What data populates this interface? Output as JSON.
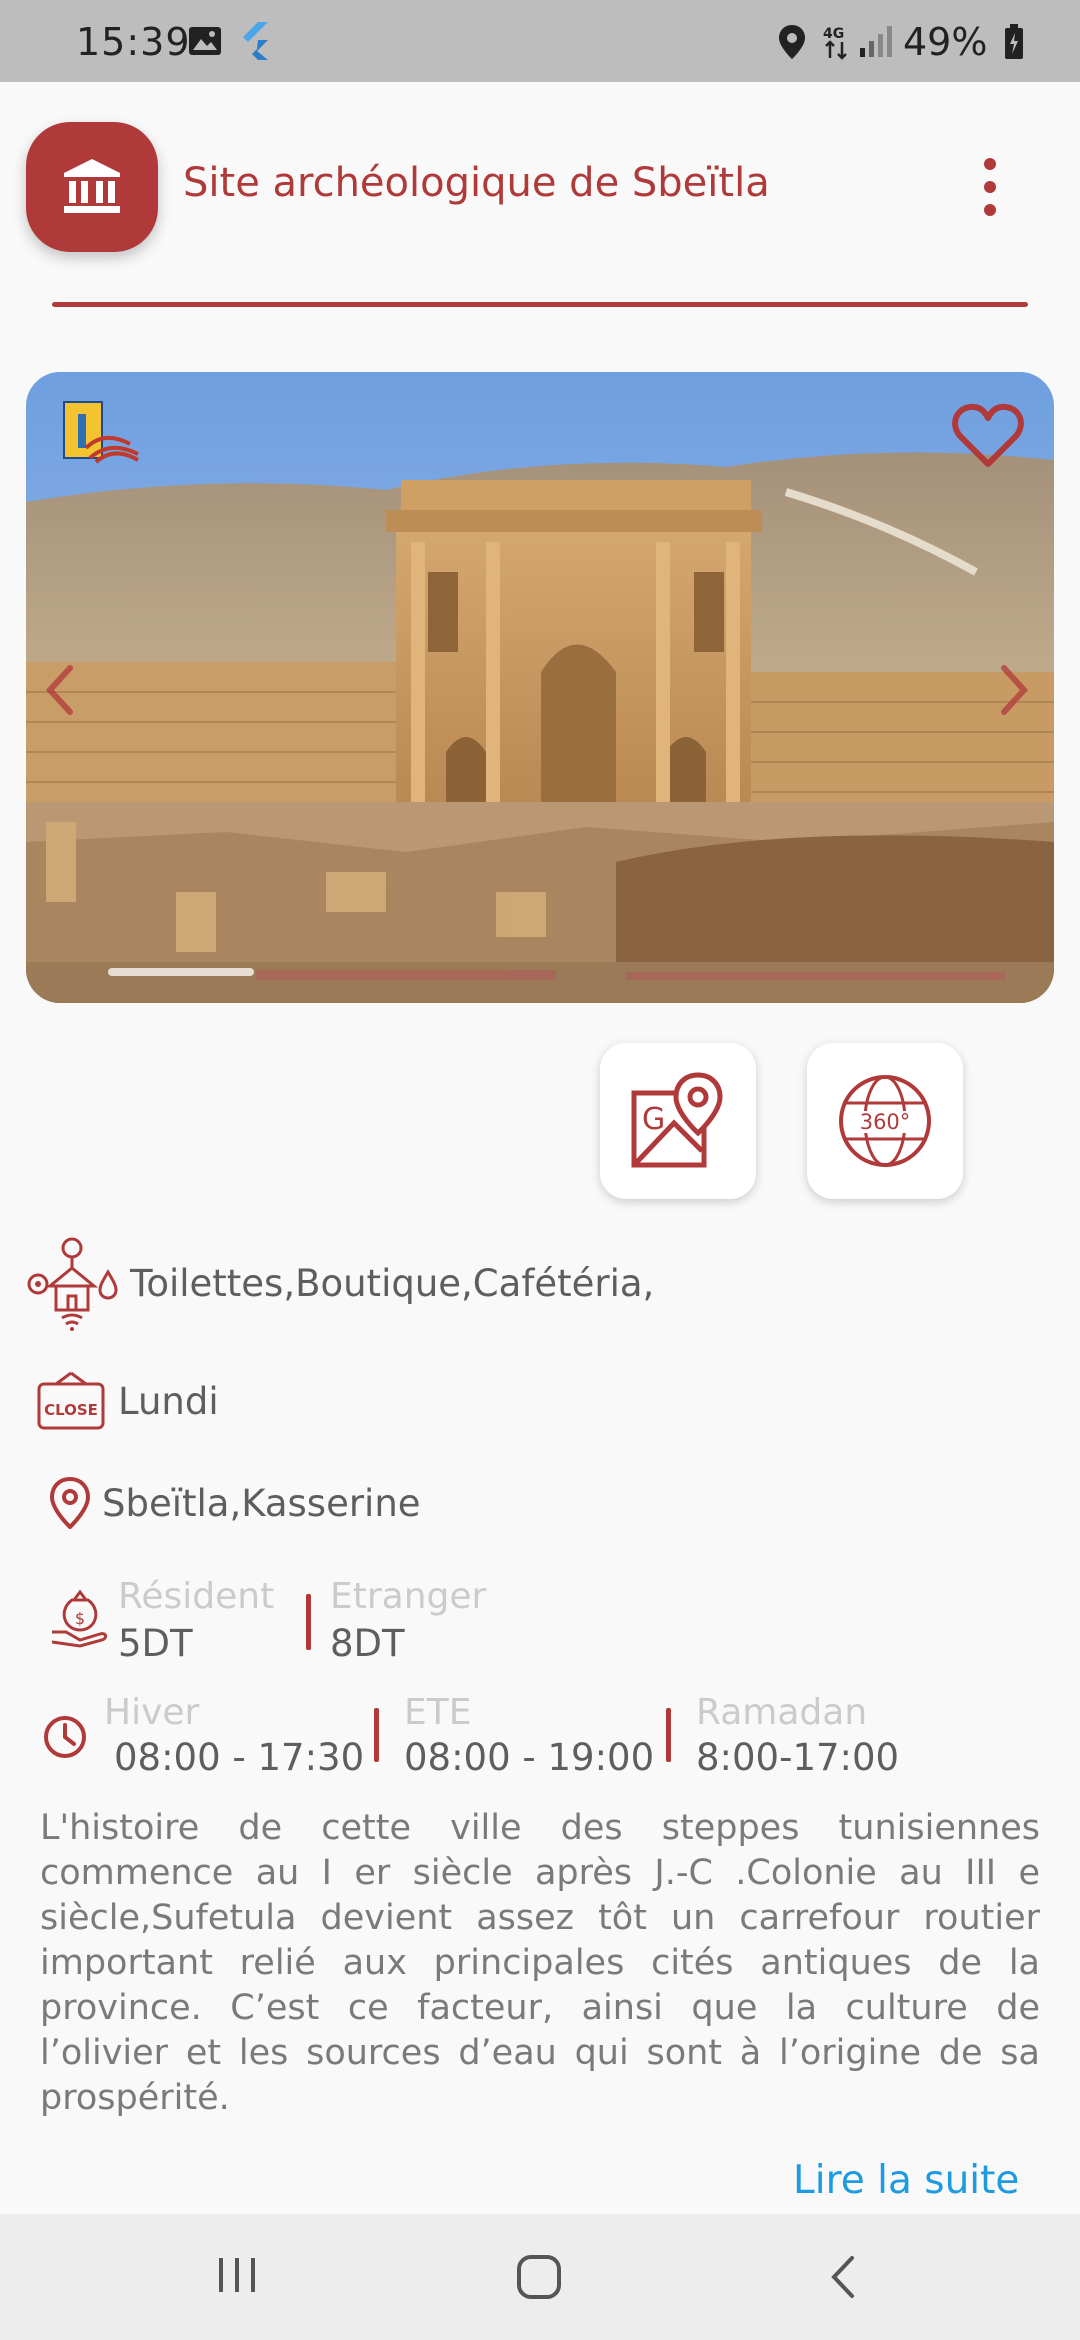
{
  "status_bar": {
    "time": "15:39",
    "battery": "49%",
    "network": "4G",
    "icons": [
      "image-icon",
      "flutter-icon",
      "location-icon",
      "network-icon",
      "signal-icon",
      "battery-icon"
    ]
  },
  "header": {
    "title": "Site archéologique de Sbeïtla",
    "logo_icon": "museum-icon",
    "menu_icon": "more-vert-icon",
    "accent_color": "#b03a3a"
  },
  "carousel": {
    "badge_icon": "ministry-logo-icon",
    "favorite_icon": "heart-outline-icon",
    "prev_icon": "chevron-left-icon",
    "next_icon": "chevron-right-icon"
  },
  "actions": {
    "map_icon": "google-maps-icon",
    "view360_icon": "view-360-icon",
    "view360_text": "360°"
  },
  "services": {
    "icon": "services-icon",
    "text": "Toilettes,Boutique,Cafétéria,"
  },
  "closing": {
    "icon": "closed-sign-icon",
    "sign_text": "CLOSE",
    "text": "Lundi"
  },
  "location": {
    "icon": "location-pin-icon",
    "text": "Sbeïtla,Kasserine"
  },
  "prices": {
    "icon": "money-hand-icon",
    "resident_label": "Résident",
    "resident_value": "5DT",
    "foreigner_label": "Etranger",
    "foreigner_value": "8DT"
  },
  "hours": {
    "icon": "clock-icon",
    "winter_label": "Hiver",
    "winter_value": "08:00 - 17:30",
    "summer_label": "ETE",
    "summer_value": "08:00 - 19:00",
    "ramadan_label": "Ramadan",
    "ramadan_value": "8:00-17:00"
  },
  "description": "L'histoire de cette ville des steppes tunisiennes commence au I er siècle après J.-C .Colonie au III e siècle,Sufetula devient assez tôt un carrefour routier important relié aux principales cités antiques de la province. C’est ce facteur, ainsi que la culture de l’olivier et les sources d’eau qui sont à l’origine de sa prospérité.",
  "read_more": "Lire la suite",
  "link_color": "#1e9be0",
  "nav_bar": {
    "recents_icon": "recents-icon",
    "home_icon": "home-icon",
    "back_icon": "back-icon"
  }
}
